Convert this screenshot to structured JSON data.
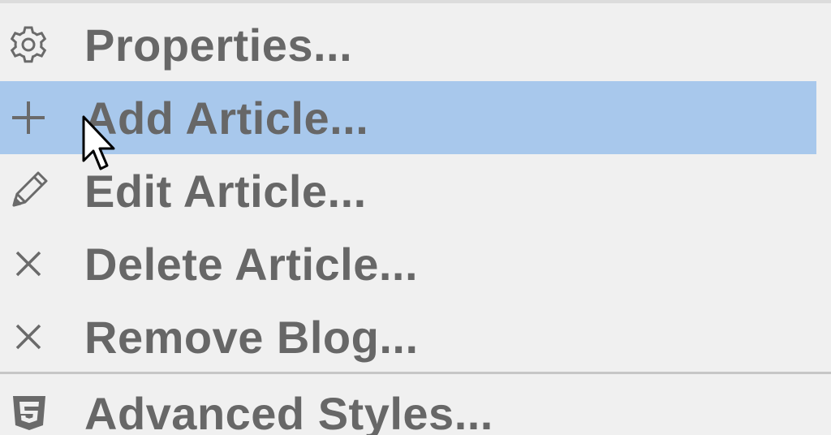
{
  "menu": {
    "items": [
      {
        "label": "Properties...",
        "icon": "gear-icon"
      },
      {
        "label": "Add Article...",
        "icon": "plus-icon",
        "highlighted": true
      },
      {
        "label": "Edit Article...",
        "icon": "pencil-icon"
      },
      {
        "label": "Delete Article...",
        "icon": "close-icon"
      },
      {
        "label": "Remove Blog...",
        "icon": "close-icon"
      },
      {
        "label": "Advanced Styles...",
        "icon": "css3-icon"
      }
    ]
  },
  "colors": {
    "background": "#f0f0f0",
    "highlight": "#a8c8ec",
    "text": "#676767",
    "separator": "#c6c6c6"
  }
}
